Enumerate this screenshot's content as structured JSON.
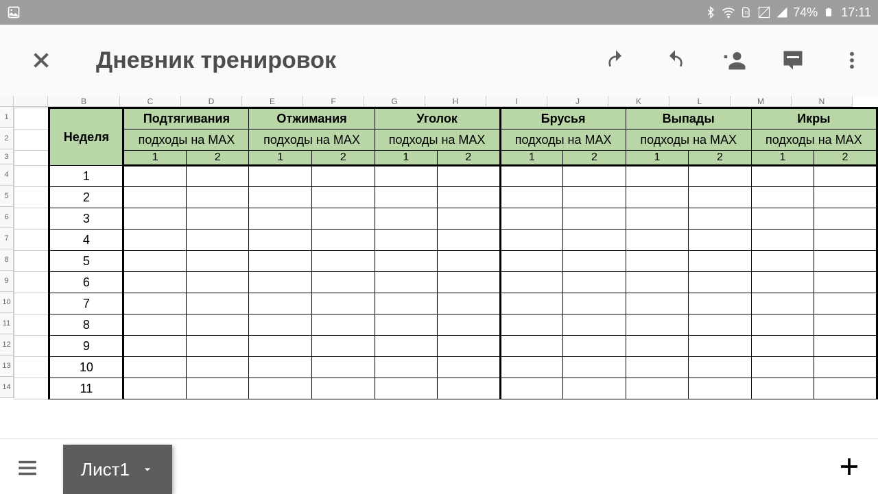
{
  "status": {
    "battery": "74%",
    "time": "17:11"
  },
  "toolbar": {
    "title": "Дневник тренировок"
  },
  "sheet": {
    "cols_a": 50,
    "cols": [
      "B",
      "C",
      "D",
      "E",
      "F",
      "G",
      "H",
      "I",
      "J",
      "K",
      "L",
      "M",
      "N"
    ],
    "col_w": {
      "B": 105,
      "other": 89
    },
    "row_nums": [
      "1",
      "2",
      "3",
      "4",
      "5",
      "6",
      "7",
      "8",
      "9",
      "10",
      "11",
      "12",
      "13",
      "14"
    ],
    "header": {
      "week": "Неделя",
      "sub": "подходы на MAX",
      "sets": [
        "1",
        "2"
      ],
      "groups": [
        "Подтягивания",
        "Отжимания",
        "Уголок",
        "Брусья",
        "Выпады",
        "Икры"
      ]
    },
    "weeks": [
      "1",
      "2",
      "3",
      "4",
      "5",
      "6",
      "7",
      "8",
      "9",
      "10",
      "11"
    ]
  },
  "bottom": {
    "tab": "Лист1"
  }
}
